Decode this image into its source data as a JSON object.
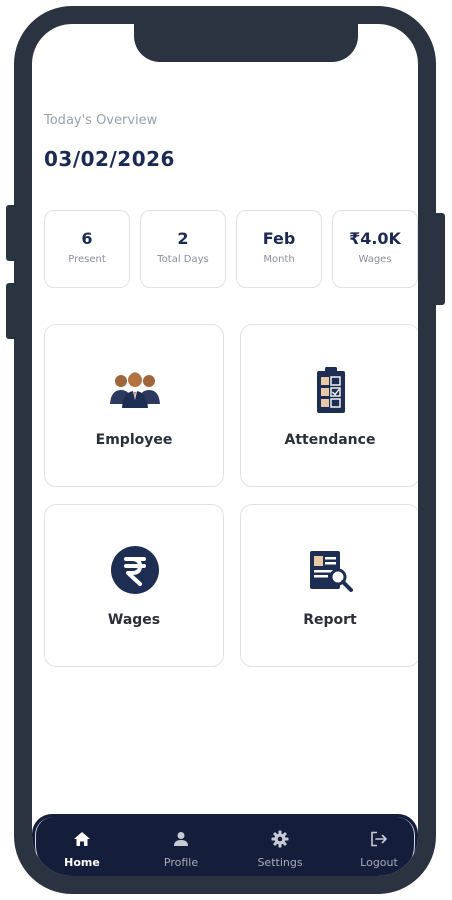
{
  "overview": {
    "label": "Today's Overview",
    "date": "03/02/2026"
  },
  "stats": [
    {
      "value": "6",
      "label": "Present"
    },
    {
      "value": "2",
      "label": "Total Days"
    },
    {
      "value": "Feb",
      "label": "Month"
    },
    {
      "value": "₹4.0K",
      "label": "Wages"
    }
  ],
  "tiles": [
    {
      "label": "Employee",
      "icon": "employees-icon"
    },
    {
      "label": "Attendance",
      "icon": "attendance-icon"
    },
    {
      "label": "Wages",
      "icon": "rupee-icon"
    },
    {
      "label": "Report",
      "icon": "report-icon"
    }
  ],
  "nav": [
    {
      "label": "Home",
      "icon": "home-icon",
      "active": true
    },
    {
      "label": "Profile",
      "icon": "person-icon",
      "active": false
    },
    {
      "label": "Settings",
      "icon": "gear-icon",
      "active": false
    },
    {
      "label": "Logout",
      "icon": "logout-icon",
      "active": false
    }
  ],
  "colors": {
    "frame": "#2c3340",
    "navy": "#1b2a52",
    "nav_bg": "#141d3a",
    "card_border": "#dfe2e7"
  }
}
